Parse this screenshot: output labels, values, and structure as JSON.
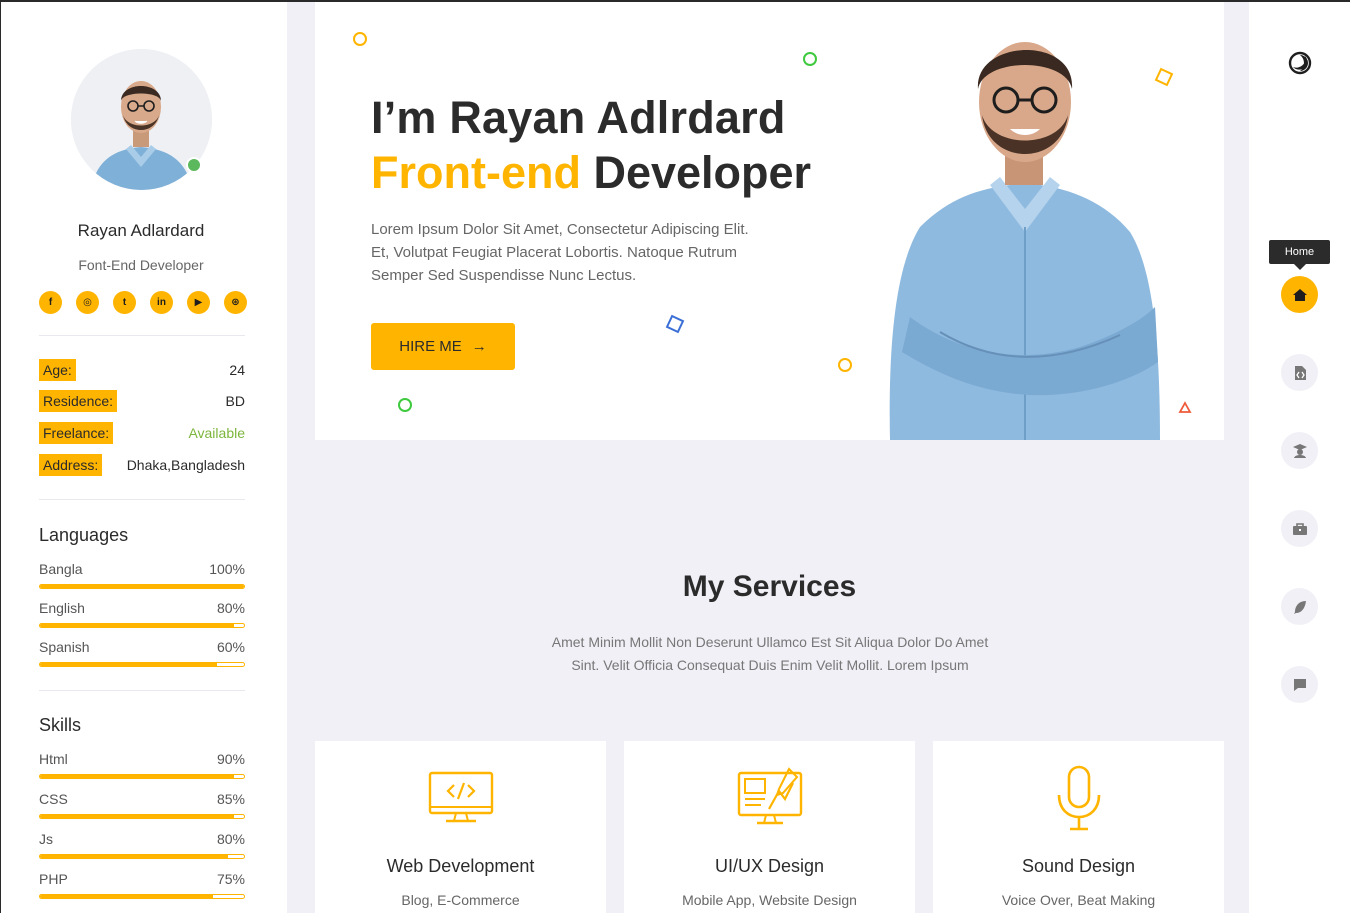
{
  "profile": {
    "name": "Rayan Adlardard",
    "role": "Font-End Developer",
    "socials": [
      {
        "icon": "facebook-icon",
        "glyph": "f"
      },
      {
        "icon": "instagram-icon",
        "glyph": "◎"
      },
      {
        "icon": "twitter-icon",
        "glyph": "t"
      },
      {
        "icon": "linkedin-icon",
        "glyph": "in"
      },
      {
        "icon": "youtube-icon",
        "glyph": "▶"
      },
      {
        "icon": "dribbble-icon",
        "glyph": "⊛"
      }
    ]
  },
  "info": [
    {
      "label": "Age:",
      "value": "24"
    },
    {
      "label": "Residence:",
      "value": "BD"
    },
    {
      "label": "Freelance:",
      "value": "Available"
    },
    {
      "label": "Address:",
      "value": "Dhaka,Bangladesh"
    }
  ],
  "languages": {
    "title": "Languages",
    "items": [
      {
        "name": "Bangla",
        "percent_label": "100%",
        "level": 1.0
      },
      {
        "name": "English",
        "percent_label": "80%",
        "level": 0.95
      },
      {
        "name": "Spanish",
        "percent_label": "60%",
        "level": 0.87
      }
    ]
  },
  "skills": {
    "title": "Skills",
    "items": [
      {
        "name": "Html",
        "percent_label": "90%",
        "level": 0.95
      },
      {
        "name": "CSS",
        "percent_label": "85%",
        "level": 0.95
      },
      {
        "name": "Js",
        "percent_label": "80%",
        "level": 0.92
      },
      {
        "name": "PHP",
        "percent_label": "75%",
        "level": 0.85
      }
    ]
  },
  "hero": {
    "line1": "I’m Rayan Adlrdard",
    "accent": "Front-end",
    "rest": " Developer",
    "description": "Lorem Ipsum Dolor Sit Amet, Consectetur Adipiscing Elit. Et, Volutpat Feugiat Placerat Lobortis. Natoque Rutrum Semper Sed Suspendisse Nunc Lectus.",
    "hire_label": "HIRE ME",
    "hire_icon": "→"
  },
  "services": {
    "title": "My Services",
    "description": "Amet Minim Mollit Non Deserunt Ullamco Est Sit Aliqua Dolor Do Amet Sint. Velit Officia Consequat Duis Enim Velit Mollit. Lorem Ipsum",
    "cards": [
      {
        "title": "Web Development",
        "subtitle": "Blog, E-Commerce",
        "icon": "monitor-code-icon"
      },
      {
        "title": "UI/UX Design",
        "subtitle": "Mobile App, Website Design",
        "icon": "design-board-icon"
      },
      {
        "title": "Sound Design",
        "subtitle": "Voice Over, Beat Making",
        "icon": "microphone-icon"
      }
    ]
  },
  "nav": {
    "tooltip": "Home",
    "items": [
      {
        "icon": "home-icon",
        "active": true
      },
      {
        "icon": "code-file-icon",
        "active": false
      },
      {
        "icon": "graduate-icon",
        "active": false
      },
      {
        "icon": "briefcase-icon",
        "active": false
      },
      {
        "icon": "feather-icon",
        "active": false
      },
      {
        "icon": "chat-icon",
        "active": false
      }
    ]
  },
  "colors": {
    "accent": "#ffb400",
    "available": "#7cb63b",
    "online": "#5cb85c"
  }
}
